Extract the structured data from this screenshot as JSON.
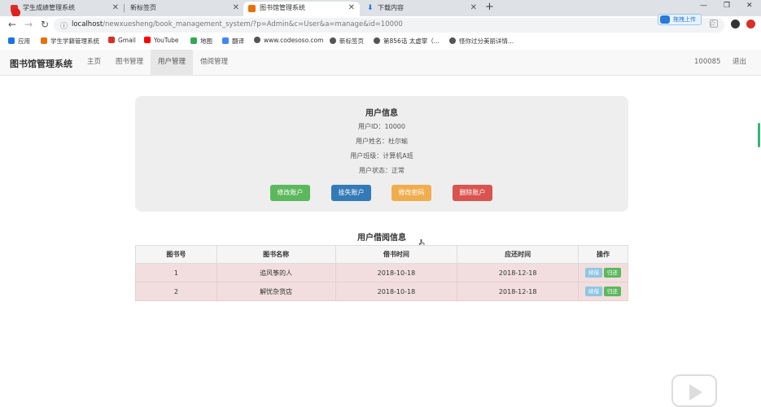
{
  "browser": {
    "tabs": [
      {
        "title": "学生成绩管理系统",
        "active": false,
        "favicon_color": "#d93025"
      },
      {
        "title": "新标签页",
        "active": false,
        "favicon_color": ""
      },
      {
        "title": "图书馆管理系统",
        "active": true,
        "favicon_color": "#e8710a"
      },
      {
        "title": "下载内容",
        "active": false,
        "favicon_color": "#1a73e8"
      }
    ],
    "new_tab_icon": "plus-icon",
    "recording_label": "Rec",
    "url_host": "localhost",
    "url_path": "/newxuesheng/book_management_system/?p=Admin&c=User&a=manage&id=10000",
    "upload_button_label": "拖拽上传",
    "window_controls": [
      "minimize-icon",
      "maximize-icon",
      "close-icon"
    ]
  },
  "bookmarks": [
    {
      "label": "应用",
      "icon": "apps-grid-icon",
      "color": "#1a73e8"
    },
    {
      "label": "学生学籍管理系统",
      "icon": "site-icon",
      "color": "#e8710a"
    },
    {
      "label": "Gmail",
      "icon": "gmail-icon",
      "color": "#d93025"
    },
    {
      "label": "YouTube",
      "icon": "youtube-icon",
      "color": "#ff0000"
    },
    {
      "label": "地图",
      "icon": "maps-icon",
      "color": "#34a853"
    },
    {
      "label": "翻译",
      "icon": "translate-icon",
      "color": "#4285f4"
    },
    {
      "label": "www.codesoso.com",
      "icon": "globe-icon",
      "color": "#555555"
    },
    {
      "label": "新标签页",
      "icon": "globe-icon",
      "color": "#555555"
    },
    {
      "label": "第856话 太虚掌（...",
      "icon": "globe-icon",
      "color": "#555555"
    },
    {
      "label": "怪你过分美丽详情...",
      "icon": "globe-icon",
      "color": "#555555"
    }
  ],
  "navbar": {
    "brand": "图书馆管理系统",
    "links": [
      "主页",
      "图书管理",
      "用户管理",
      "借阅管理"
    ],
    "active_link": "用户管理",
    "user_id": "100085",
    "logout": "退出"
  },
  "user_info": {
    "title": "用户信息",
    "lines": [
      "用户ID：10000",
      "用户姓名：杜尔瑜",
      "用户班级：计算机A班",
      "用户状态：正常"
    ],
    "buttons": [
      {
        "label": "修改账户",
        "style": "green"
      },
      {
        "label": "挂失账户",
        "style": "blue"
      },
      {
        "label": "修改密码",
        "style": "orange"
      },
      {
        "label": "删除账户",
        "style": "red"
      }
    ]
  },
  "borrow_info": {
    "title": "用户借阅信息",
    "columns": [
      "图书号",
      "图书名称",
      "借书时间",
      "应还时间",
      "操作"
    ],
    "rows": [
      {
        "id": "1",
        "name": "追风筝的人",
        "borrow_date": "2018-10-18",
        "due_date": "2018-12-18",
        "renew": "续借",
        "return": "归还"
      },
      {
        "id": "2",
        "name": "解忧杂货店",
        "borrow_date": "2018-10-18",
        "due_date": "2018-12-18",
        "renew": "续借",
        "return": "归还"
      }
    ]
  }
}
